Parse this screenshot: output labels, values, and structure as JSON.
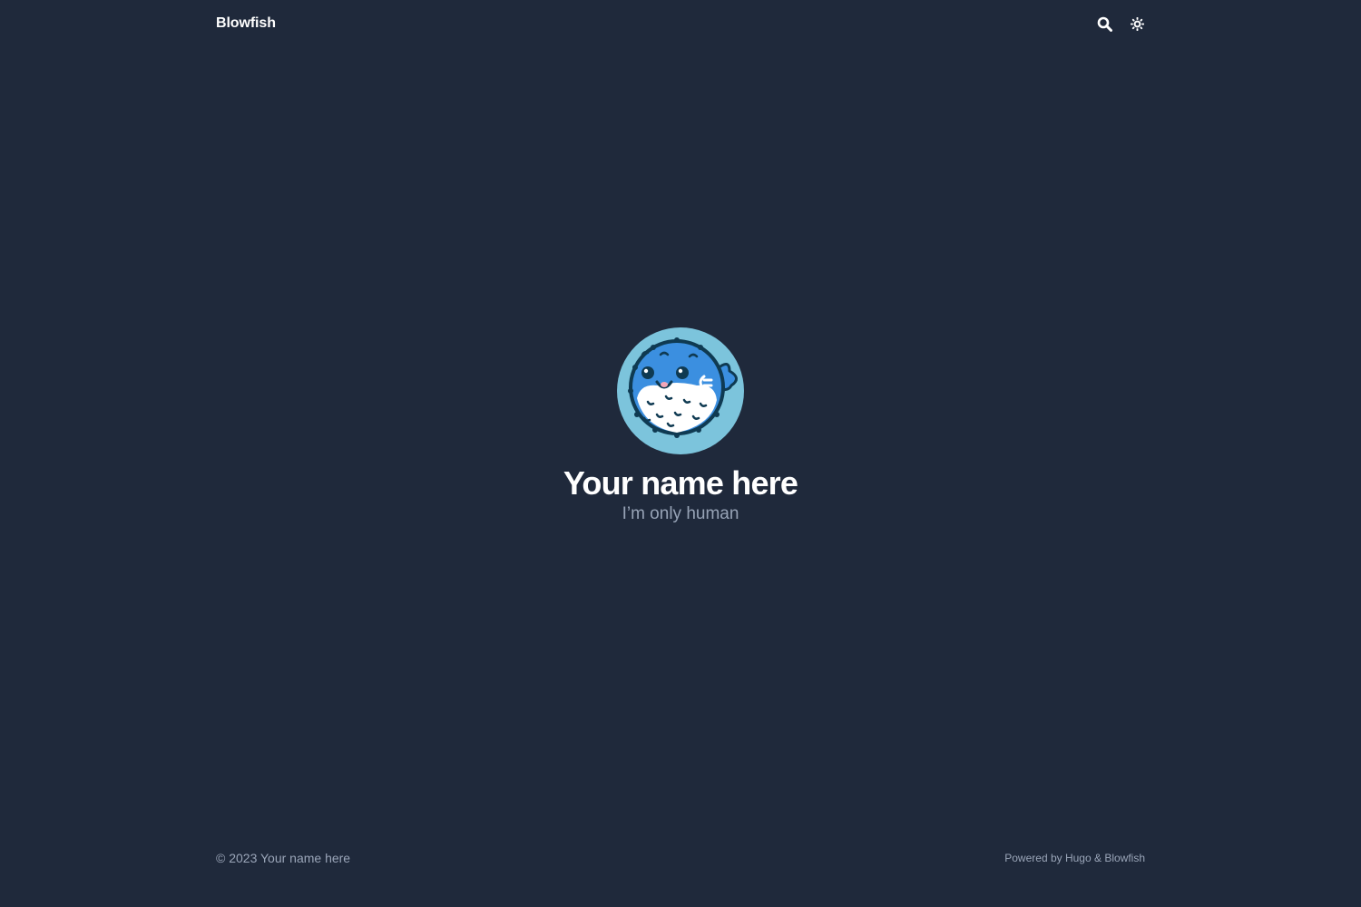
{
  "header": {
    "site_title": "Blowfish",
    "search_icon": "search-icon",
    "theme_icon": "sun-gear-icon"
  },
  "hero": {
    "avatar_icon": "blowfish-logo",
    "name": "Your name here",
    "tagline": "I’m only human"
  },
  "footer": {
    "copyright": "© 2023 Your name here",
    "powered_prefix": "Powered by ",
    "hugo_link": "Hugo",
    "and": " & ",
    "blowfish_link": "Blowfish"
  },
  "colors": {
    "background": "#1f293b",
    "avatar_bg": "#7cc4dc",
    "fish_blue": "#3b8fe0",
    "muted_text": "#97a3b6"
  }
}
